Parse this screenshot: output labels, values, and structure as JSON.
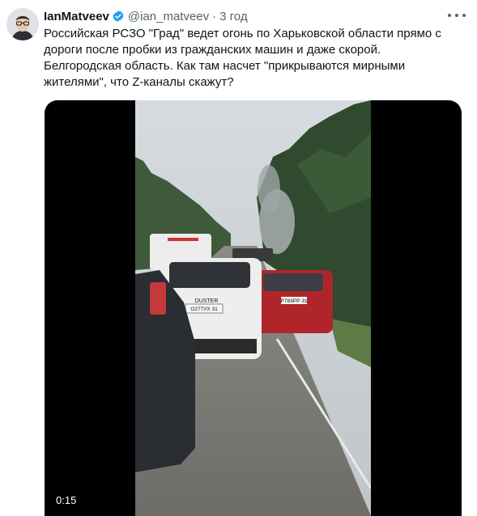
{
  "author": {
    "name": "IanMatveev",
    "handle": "@ian_matveev",
    "separator": "·",
    "time": "3 год"
  },
  "tweet": {
    "lines": [
      "Российская РСЗО \"Град\" ведет огонь по Харьковской области прямо с",
      "дороги после пробки из гражданских машин и даже скорой.",
      "Белгородская область. Как там насчет \"прикрываются мирными",
      "жителями\", что Z-каналы скажут?"
    ]
  },
  "media": {
    "timestamp": "0:15",
    "plates": [
      "О277УХ 31",
      "Р783РР 31"
    ],
    "badge": "DUSTER"
  },
  "icons": {
    "verified": "verified-badge-icon",
    "more": "more-horizontal-icon"
  },
  "colors": {
    "verified": "#1d9bf0",
    "secondary_text": "#536471",
    "text": "#0f1419"
  }
}
